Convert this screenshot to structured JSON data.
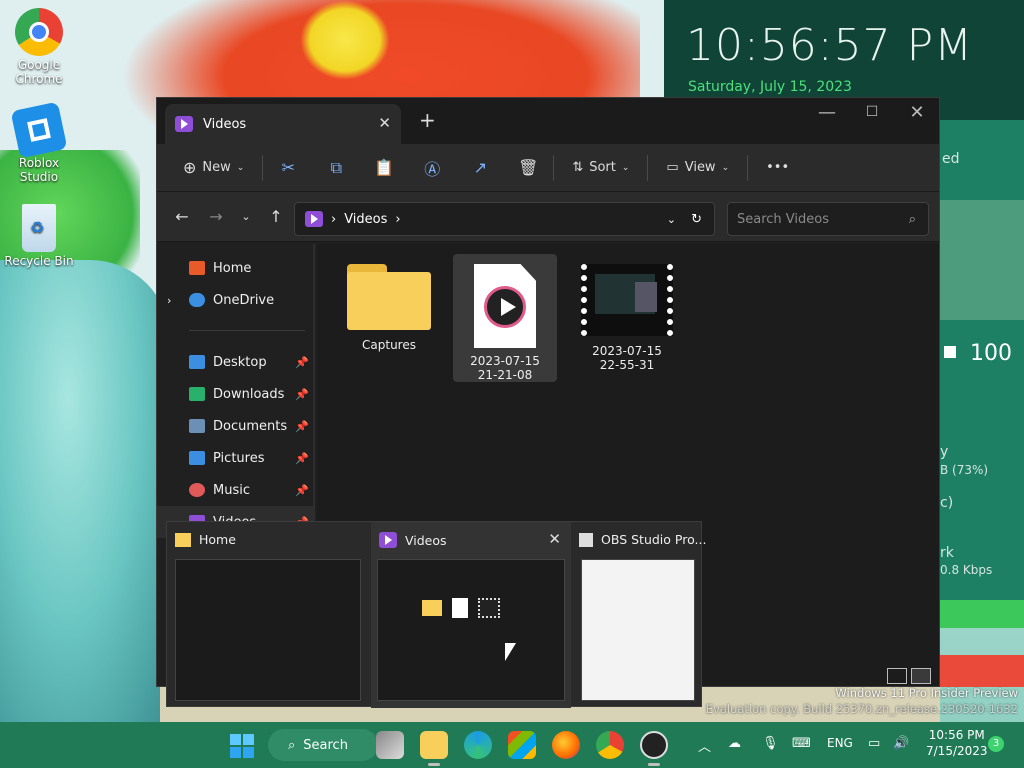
{
  "desktop": {
    "clock": "10:56:57 PM",
    "date": "Saturday, July 15, 2023",
    "side_fragments": [
      "ed",
      "100",
      "y",
      "B (73%)",
      "c)",
      "rk",
      "0.8 Kbps"
    ],
    "icons": [
      {
        "label": "Google Chrome",
        "icon": "chrome-icon"
      },
      {
        "label": "Roblox Studio",
        "icon": "roblox-studio-icon"
      },
      {
        "label": "Recycle Bin",
        "icon": "recycle-bin-icon"
      }
    ],
    "watermark": [
      "Windows 11 Pro Insider Preview",
      "Evaluation copy. Build 25370.zn_release.230520-1632"
    ]
  },
  "explorer": {
    "tab_title": "Videos",
    "toolbar": {
      "new_label": "New",
      "sort_label": "Sort",
      "view_label": "View",
      "more_label": "•••"
    },
    "address": {
      "path": [
        "Videos"
      ],
      "search_placeholder": "Search Videos"
    },
    "nav": [
      {
        "label": "Home",
        "icon": "home-icon",
        "color": "#e85a2a"
      },
      {
        "label": "OneDrive",
        "icon": "onedrive-icon",
        "color": "#3c8fe0"
      },
      {
        "label": "Desktop",
        "icon": "desktop-icon",
        "color": "#3c8fe0"
      },
      {
        "label": "Downloads",
        "icon": "download-icon",
        "color": "#29b06b"
      },
      {
        "label": "Documents",
        "icon": "documents-icon",
        "color": "#6b8fb5"
      },
      {
        "label": "Pictures",
        "icon": "pictures-icon",
        "color": "#3c8fe0"
      },
      {
        "label": "Music",
        "icon": "music-icon",
        "color": "#e05a5a"
      },
      {
        "label": "Videos",
        "icon": "videos-icon",
        "color": "#8e4fd6"
      }
    ],
    "files": [
      {
        "name": "Captures",
        "kind": "folder"
      },
      {
        "name": "2023-07-15 21-21-08",
        "kind": "video"
      },
      {
        "name": "2023-07-15 22-55-31",
        "kind": "video-thumb"
      }
    ]
  },
  "previews": [
    {
      "title": "Home"
    },
    {
      "title": "Videos"
    },
    {
      "title": "OBS Studio Pro..."
    }
  ],
  "taskbar": {
    "search_label": "Search",
    "lang": "ENG",
    "time": "10:56 PM",
    "date": "7/15/2023",
    "badge": "3"
  }
}
